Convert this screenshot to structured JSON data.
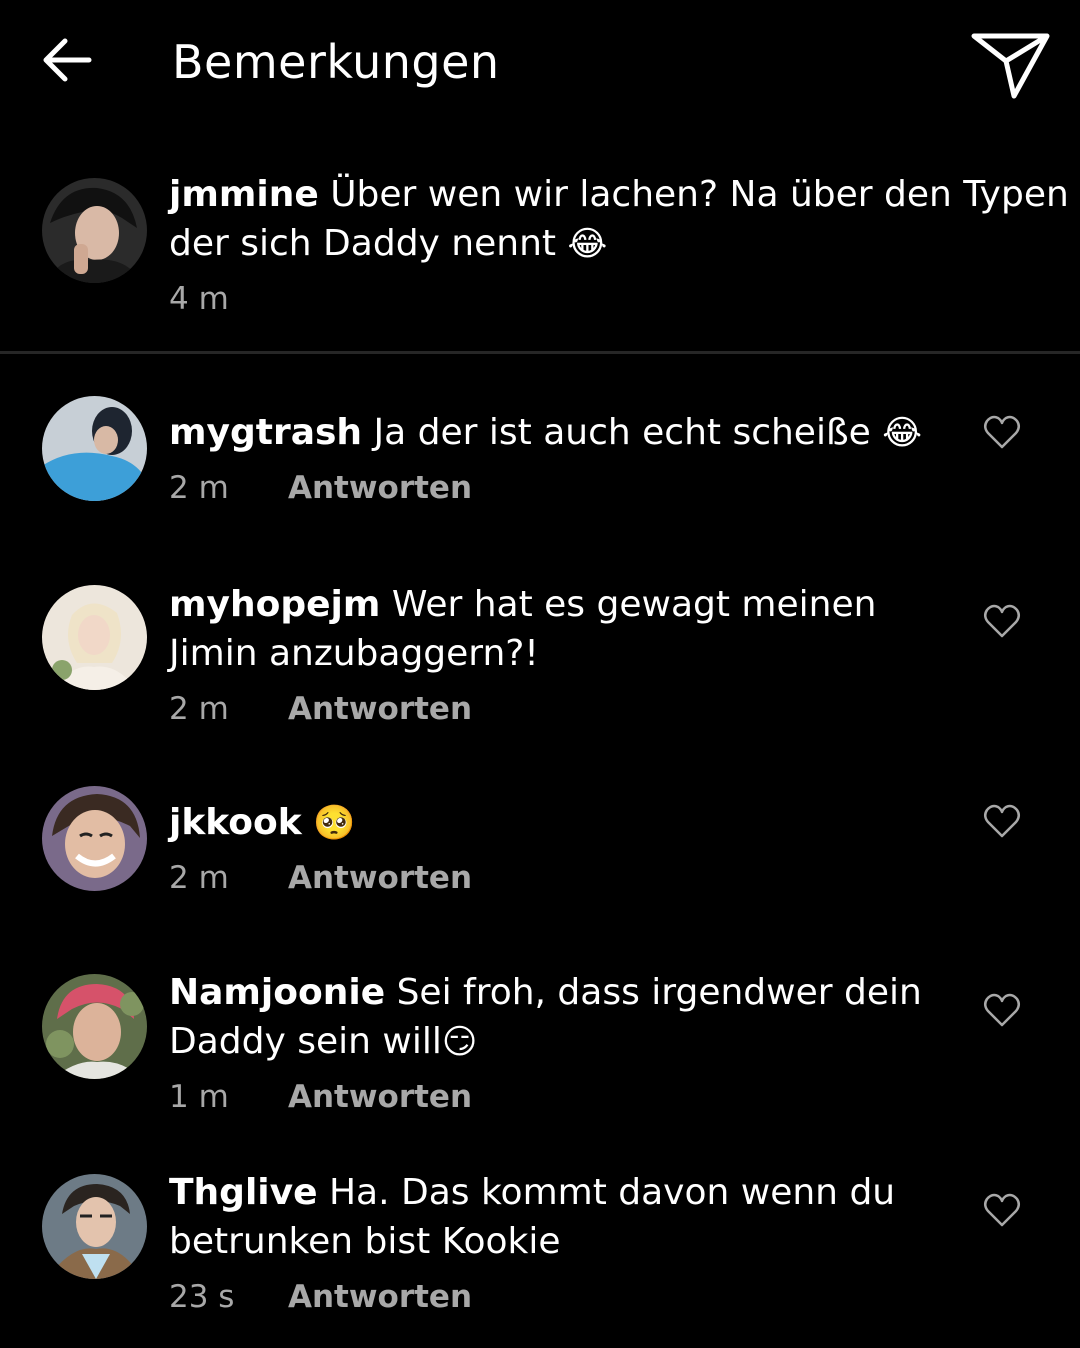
{
  "header": {
    "title": "Bemerkungen",
    "back_icon": "arrow-left-icon",
    "share_icon": "paper-plane-icon"
  },
  "caption": {
    "username": "jmmine",
    "text": "Über wen wir lachen? Na über den Typen der sich Daddy nennt",
    "emoji": "😂",
    "time": "4 m"
  },
  "comments": [
    {
      "username": "mygtrash",
      "text": "Ja der ist auch echt scheiße",
      "emoji": "😂",
      "time": "2 m",
      "reply_label": "Antworten"
    },
    {
      "username": "myhopejm",
      "text": "Wer hat es gewagt meinen Jimin anzubaggern?!",
      "emoji": "",
      "time": "2 m",
      "reply_label": "Antworten"
    },
    {
      "username": "jkkook",
      "text": "",
      "emoji": "🥺",
      "time": "2 m",
      "reply_label": "Antworten"
    },
    {
      "username": "Namjoonie",
      "text": "Sei froh, dass irgendwer dein Daddy sein will",
      "emoji": "😏",
      "time": "1 m",
      "reply_label": "Antworten"
    },
    {
      "username": "Thglive",
      "text": "Ha. Das kommt davon wenn du betrunken bist Kookie",
      "emoji": "",
      "time": "23 s",
      "reply_label": "Antworten"
    }
  ],
  "colors": {
    "background": "#000000",
    "text": "#ffffff",
    "secondary_text": "#a8a8a8",
    "divider": "#262626"
  }
}
